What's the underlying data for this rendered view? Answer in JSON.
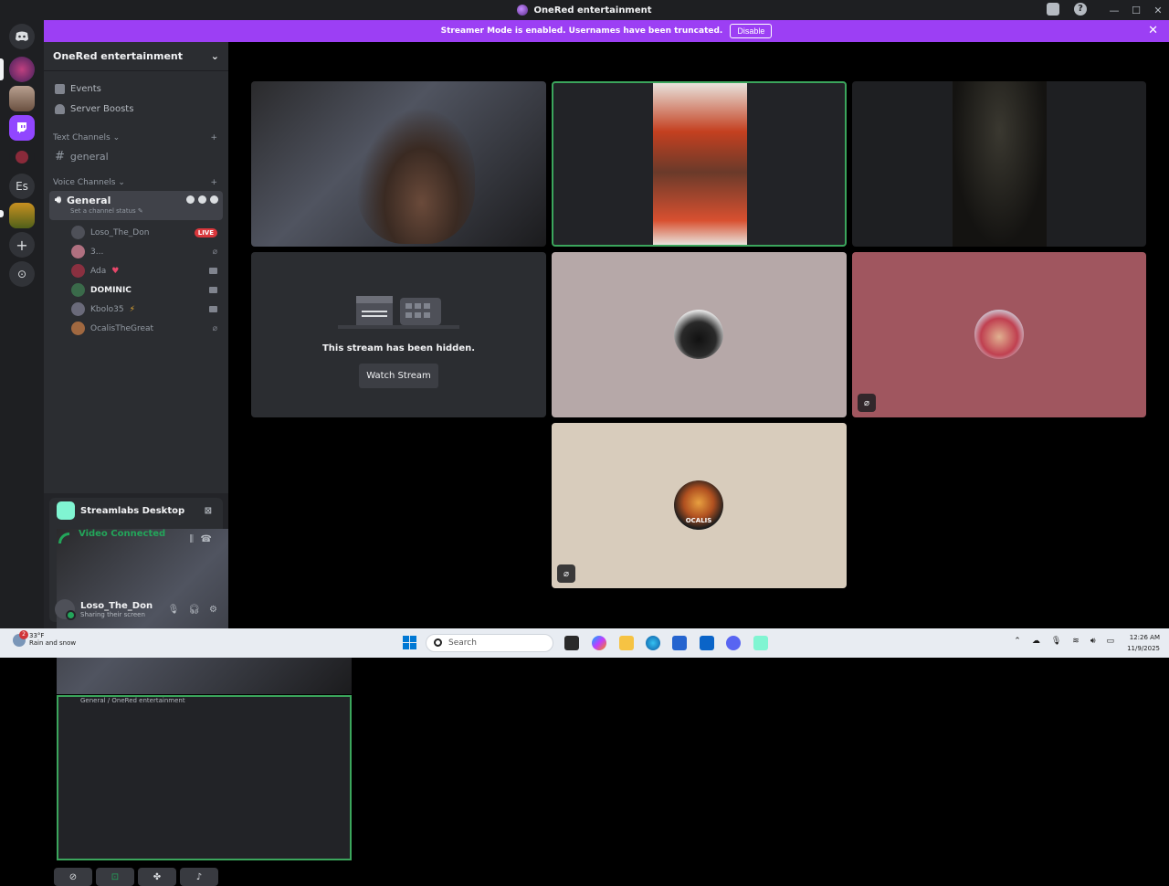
{
  "window": {
    "title": "OneRed entertainment"
  },
  "banner": {
    "text": "Streamer Mode is enabled. Usernames have been truncated.",
    "disable_label": "Disable"
  },
  "rail": {
    "dm_label": "",
    "server_es": "Es",
    "add_label": "+",
    "discover_label": "⊙"
  },
  "server": {
    "name": "OneRed entertainment"
  },
  "nav": {
    "events": "Events",
    "boosts": "Server Boosts"
  },
  "text_channels": {
    "header": "Text Channels",
    "items": [
      "general"
    ]
  },
  "voice_channels": {
    "header": "Voice Channels",
    "channel": {
      "name": "General",
      "status": "Set a channel status"
    },
    "users": [
      {
        "name": "Loso_The_Don",
        "badge": "LIVE"
      },
      {
        "name": "3..."
      },
      {
        "name": "Ada"
      },
      {
        "name": "DOMINIC"
      },
      {
        "name": "Kbolo35"
      },
      {
        "name": "OcalisTheGreat"
      }
    ]
  },
  "activity": {
    "app_name": "Streamlabs Desktop",
    "status": "Video Connected",
    "location": "General / OneRed entertainment"
  },
  "user": {
    "name": "Loso_The_Don",
    "status": "Sharing their screen"
  },
  "stage": {
    "hidden_title": "This stream has been hidden.",
    "watch_label": "Watch Stream",
    "avatar_text": "OCALIS"
  },
  "taskbar": {
    "weather_temp": "33°F",
    "weather_desc": "Rain and snow",
    "weather_badge": "2",
    "search_placeholder": "Search",
    "time": "12:26 AM",
    "date": "11/9/2025"
  },
  "colors": {
    "accent": "#9c3ff4",
    "online": "#23a55a",
    "live": "#da373c",
    "speaking_border": "#3ba55c"
  }
}
